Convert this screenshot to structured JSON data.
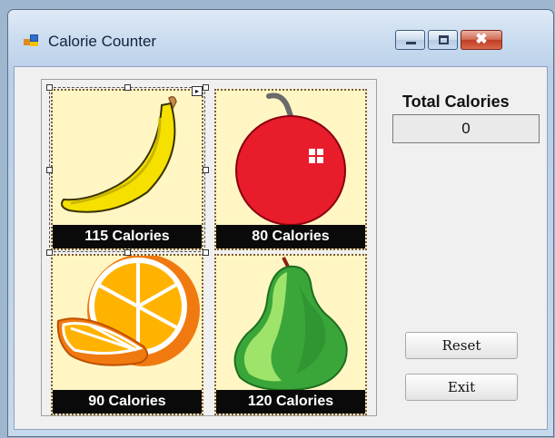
{
  "window": {
    "title": "Calorie Counter",
    "icons": {
      "app": "form-icon",
      "minimize": "minimize-icon",
      "maximize": "maximize-icon",
      "close": "close-icon"
    },
    "close_glyph": "✖"
  },
  "foods": [
    {
      "name": "banana",
      "label": "115 Calories",
      "icon": "banana-icon"
    },
    {
      "name": "apple",
      "label": "80 Calories",
      "icon": "apple-icon"
    },
    {
      "name": "orange",
      "label": "90 Calories",
      "icon": "orange-icon"
    },
    {
      "name": "pear",
      "label": "120 Calories",
      "icon": "pear-icon"
    }
  ],
  "total": {
    "title": "Total Calories",
    "value": "0"
  },
  "buttons": {
    "reset": "Reset",
    "exit": "Exit"
  },
  "designer": {
    "smart_tag_glyph": "▸"
  },
  "colors": {
    "cell_bg": "#fff6c4",
    "label_bg": "#0a0a0a",
    "client_bg": "#f0f0f0"
  }
}
